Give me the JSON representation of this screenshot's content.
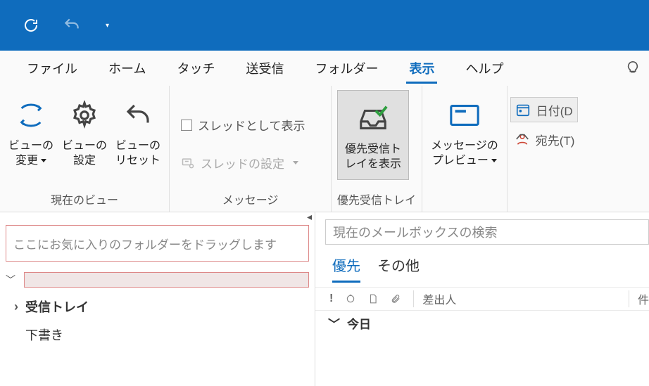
{
  "qat": {
    "customize_tooltip": "▾"
  },
  "tabs": {
    "file": "ファイル",
    "home": "ホーム",
    "touch": "タッチ",
    "sendreceive": "送受信",
    "folder": "フォルダー",
    "view": "表示",
    "help": "ヘルプ"
  },
  "ribbon": {
    "current_view": {
      "change_view": "ビューの\n変更",
      "view_settings": "ビューの\n設定",
      "reset_view": "ビューの\nリセット",
      "group_label": "現在のビュー"
    },
    "messages": {
      "show_as_thread": "スレッドとして表示",
      "thread_settings": "スレッドの設定",
      "group_label": "メッセージ"
    },
    "focused_inbox": {
      "button": "優先受信ト\nレイを表示",
      "group_label": "優先受信トレイ"
    },
    "preview": {
      "button": "メッセージの\nプレビュー"
    },
    "arrangement": {
      "date": "日付(D",
      "to": "宛先(T)"
    }
  },
  "leftpane": {
    "favorites_placeholder": "ここにお気に入りのフォルダーをドラッグします",
    "inbox": "受信トレイ",
    "drafts": "下書き"
  },
  "rightpane": {
    "search_placeholder": "現在のメールボックスの検索",
    "focused": "優先",
    "other": "その他",
    "col_from": "差出人",
    "col_subject": "件",
    "today": "今日"
  }
}
